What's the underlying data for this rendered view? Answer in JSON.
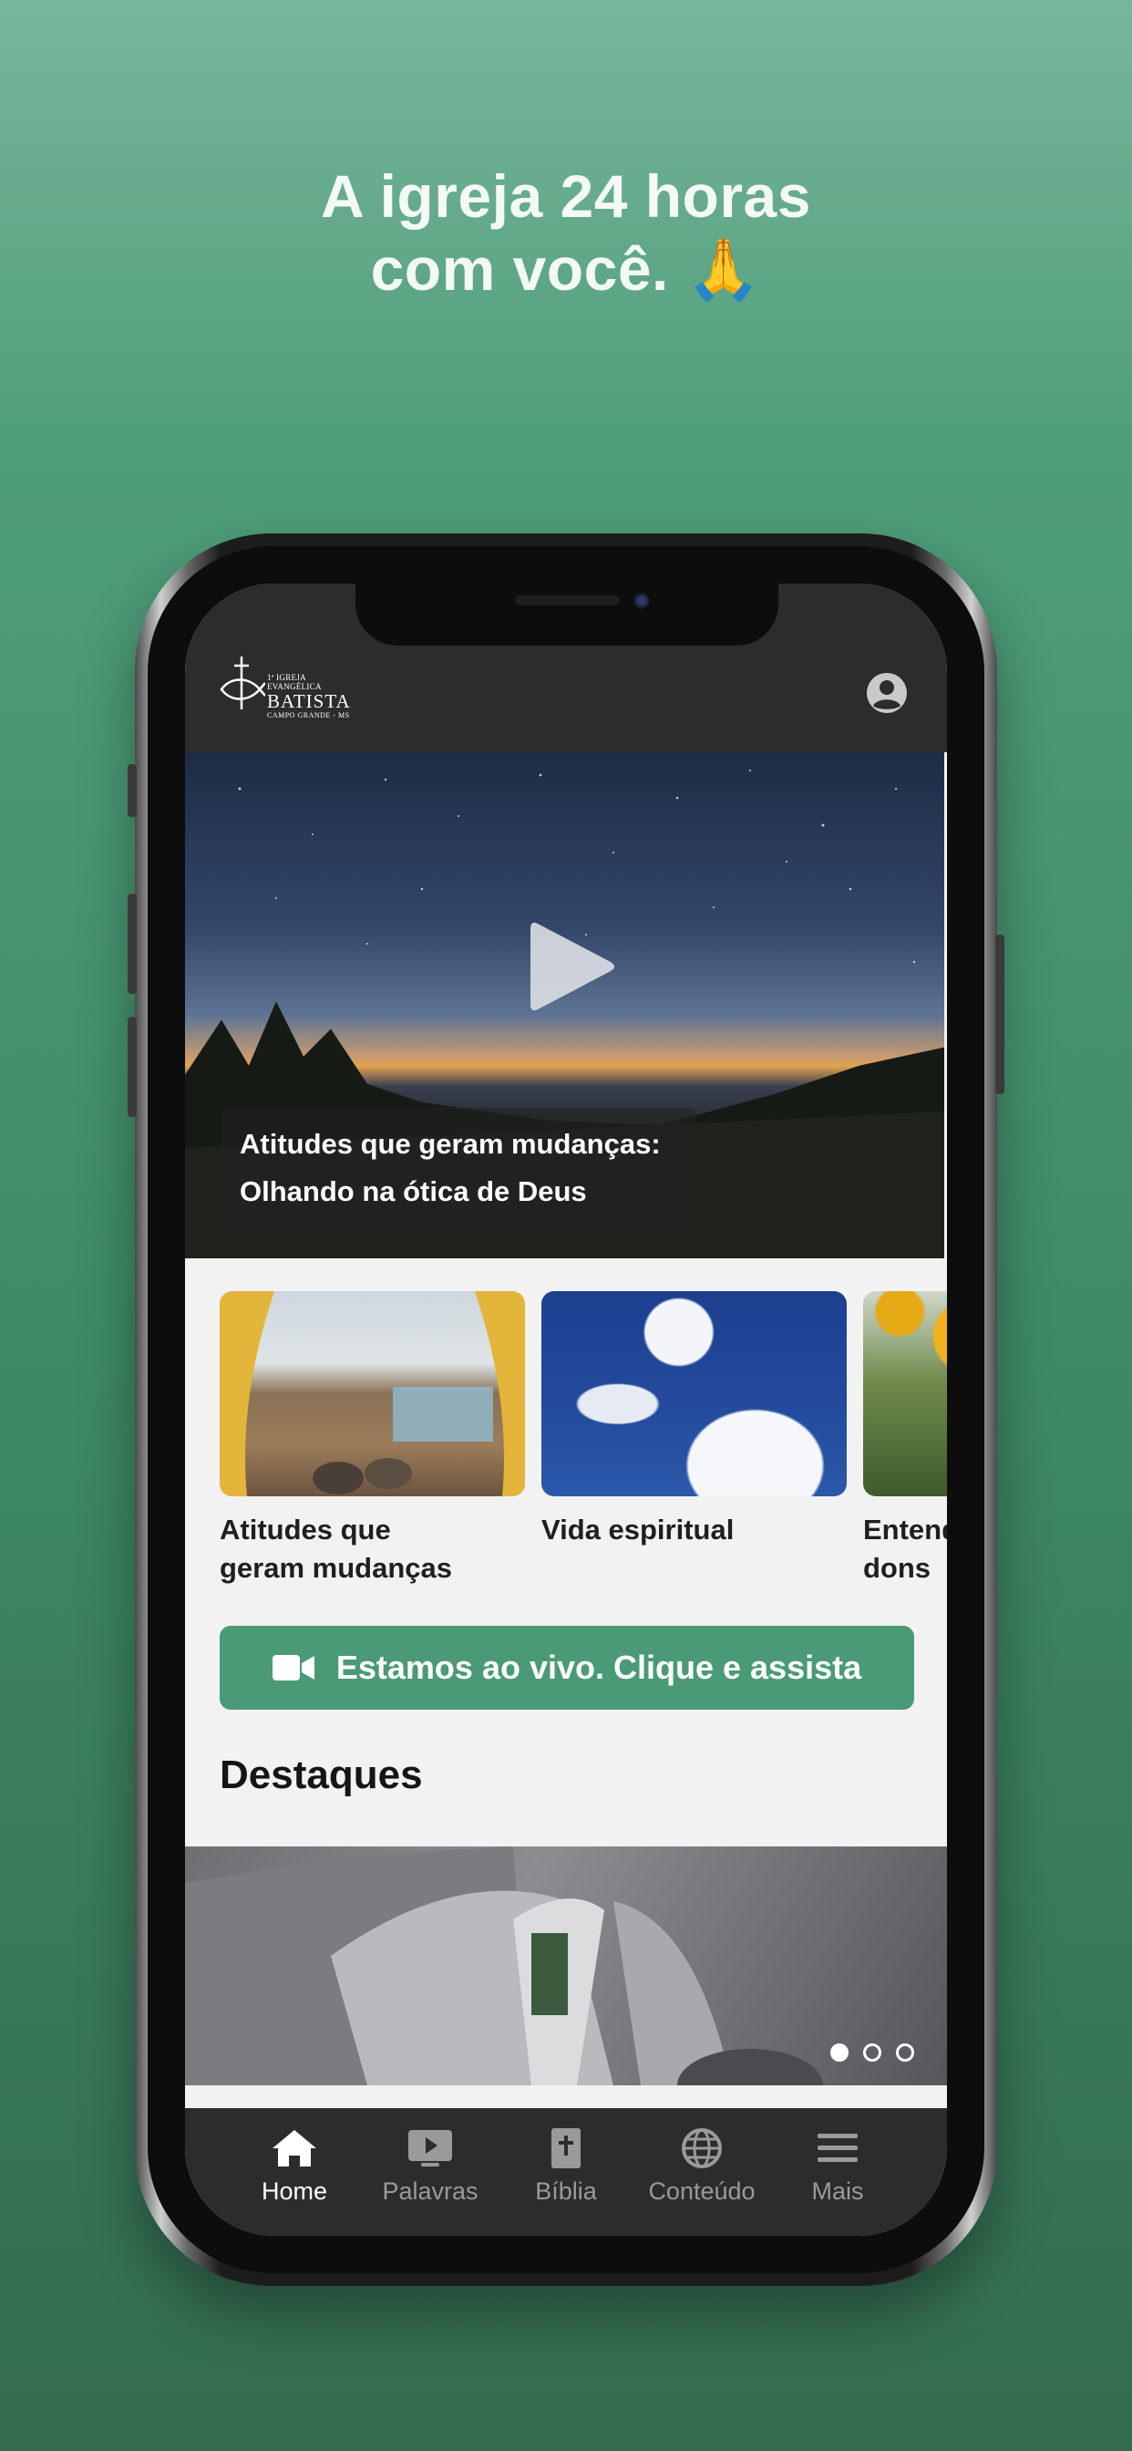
{
  "headline": {
    "line1": "A igreja 24 horas",
    "line2": "com você.",
    "emoji": "🙏"
  },
  "header": {
    "logo": {
      "line_top": "1ª IGREJA EVANGÉLICA",
      "line_main": "BATISTA",
      "line_bottom": "CAMPO GRANDE - MS"
    },
    "profile_icon": "user-circle-icon"
  },
  "hero": {
    "title_line1": "Atitudes que geram mudanças:",
    "title_line2": "Olhando na ótica de Deus",
    "play_icon": "play-icon"
  },
  "cards": [
    {
      "title_line1": "Atitudes que",
      "title_line2": "geram mudanças"
    },
    {
      "title_line1": "Vida espiritual",
      "title_line2": ""
    },
    {
      "title_line1": "Entend",
      "title_line2": "dons"
    }
  ],
  "live_button": {
    "label": "Estamos ao vivo. Clique e assista",
    "icon": "video-camera-icon"
  },
  "featured": {
    "section_title": "Destaques",
    "slides_total": 3,
    "active_slide": 1
  },
  "tabbar": {
    "items": [
      {
        "label": "Home",
        "icon": "home-icon",
        "active": true
      },
      {
        "label": "Palavras",
        "icon": "video-play-icon",
        "active": false
      },
      {
        "label": "Bíblia",
        "icon": "bible-icon",
        "active": false
      },
      {
        "label": "Conteúdo",
        "icon": "globe-icon",
        "active": false
      },
      {
        "label": "Mais",
        "icon": "menu-icon",
        "active": false
      }
    ]
  },
  "colors": {
    "background_top": "#78b69c",
    "background_bottom": "#336b50",
    "live_button": "#4a9a75",
    "header_bg": "#2b2c2e"
  }
}
